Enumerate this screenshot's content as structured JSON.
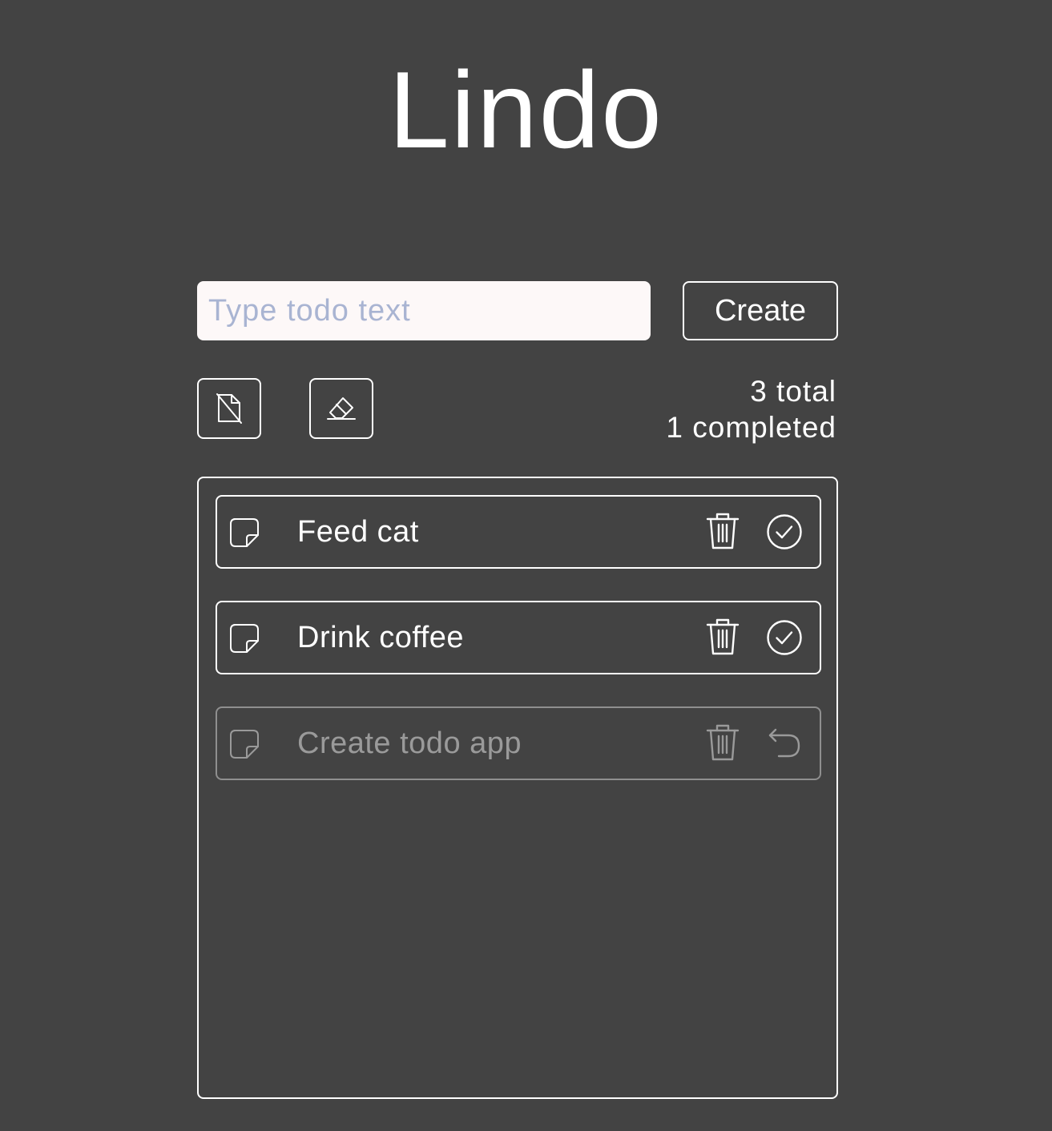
{
  "app": {
    "title": "Lindo"
  },
  "new_todo": {
    "value": "",
    "placeholder": "Type todo text",
    "create_label": "Create"
  },
  "toolbar": {
    "clear_notes_icon": "note-slash-icon",
    "erase_completed_icon": "eraser-icon"
  },
  "stats": {
    "total": "3 total",
    "completed": "1 completed"
  },
  "todos": [
    {
      "text": "Feed cat",
      "completed": false,
      "action_icon": "check-circle-icon"
    },
    {
      "text": "Drink coffee",
      "completed": false,
      "action_icon": "check-circle-icon"
    },
    {
      "text": "Create todo app",
      "completed": true,
      "action_icon": "undo-icon"
    }
  ],
  "colors": {
    "background": "#434343",
    "foreground": "#ffffff",
    "input_background": "#fdf8f8",
    "placeholder": "#a9b4d2",
    "completed": "#9a9a9a"
  }
}
